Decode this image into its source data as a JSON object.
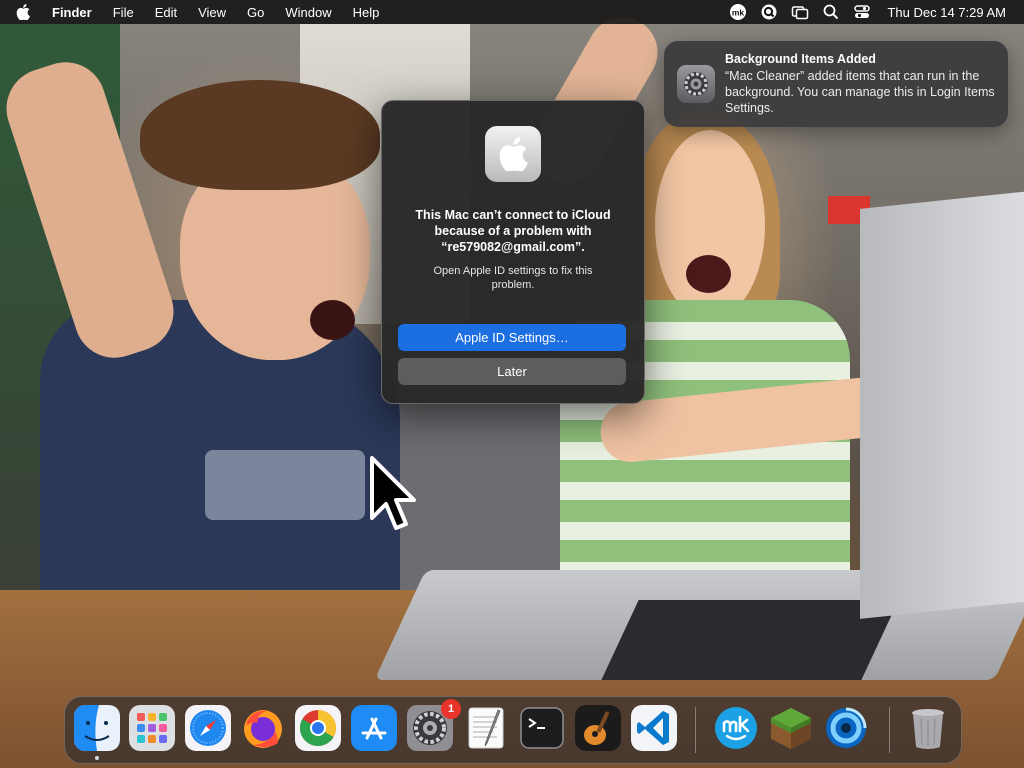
{
  "menubar": {
    "app_name": "Finder",
    "menus": [
      "File",
      "Edit",
      "View",
      "Go",
      "Window",
      "Help"
    ],
    "status_icons": [
      "mk-app-icon",
      "search-widget-icon",
      "screen-mirroring-icon",
      "spotlight-search-icon",
      "control-center-icon"
    ],
    "clock": "Thu Dec 14  7:29 AM"
  },
  "notification": {
    "icon": "system-settings-gear-icon",
    "title": "Background Items Added",
    "body": "“Mac Cleaner” added items that can run in the background. You can manage this in Login Items Settings."
  },
  "dialog": {
    "icon": "apple-logo-icon",
    "title": "This Mac can’t connect to iCloud because of a problem with “re579082@gmail.com”.",
    "message": "Open Apple ID settings to fix this problem.",
    "primary_button": "Apple ID Settings…",
    "secondary_button": "Later",
    "accent": "#1c6fe0"
  },
  "dock": {
    "items": [
      {
        "app": "Finder",
        "icon": "finder-icon",
        "running": true
      },
      {
        "app": "Launchpad",
        "icon": "launchpad-icon"
      },
      {
        "app": "Safari",
        "icon": "safari-icon"
      },
      {
        "app": "Firefox",
        "icon": "firefox-icon"
      },
      {
        "app": "Google Chrome",
        "icon": "chrome-icon"
      },
      {
        "app": "App Store",
        "icon": "app-store-icon"
      },
      {
        "app": "System Settings",
        "icon": "system-settings-icon",
        "badge": "1"
      },
      {
        "app": "TextEdit",
        "icon": "textedit-icon"
      },
      {
        "app": "Terminal",
        "icon": "terminal-icon"
      },
      {
        "app": "GarageBand",
        "icon": "garageband-icon"
      },
      {
        "app": "Visual Studio Code",
        "icon": "vscode-icon"
      },
      {
        "app": "MacKeeper",
        "icon": "mackeeper-icon"
      },
      {
        "app": "Minecraft",
        "icon": "minecraft-icon"
      },
      {
        "app": "Unknown App",
        "icon": "blue-ring-app-icon"
      },
      {
        "app": "Trash",
        "icon": "trash-icon"
      }
    ]
  }
}
